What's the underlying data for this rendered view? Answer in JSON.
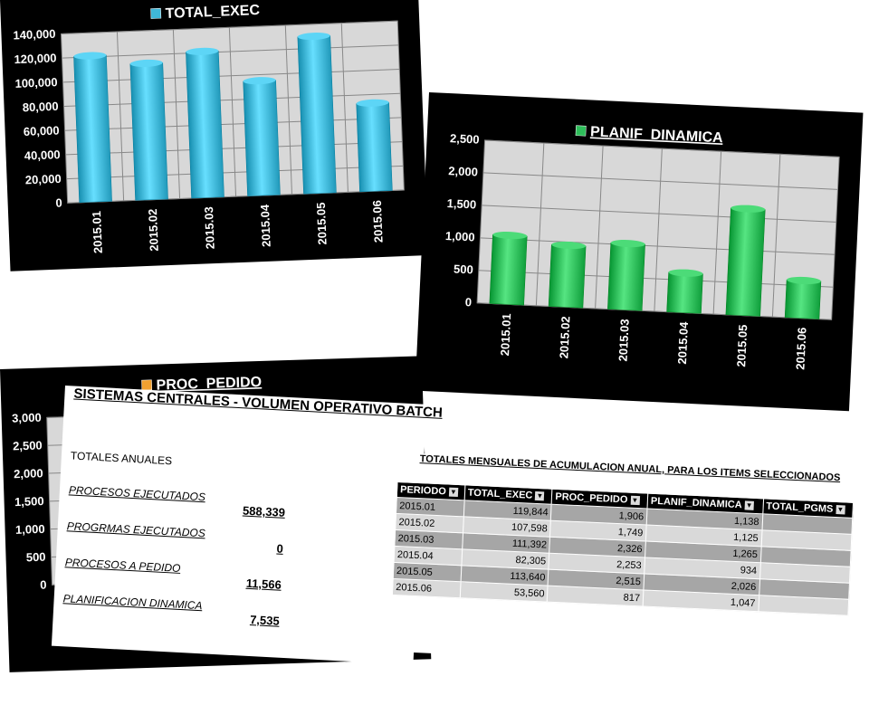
{
  "chart_data": [
    {
      "id": "total_exec",
      "type": "bar",
      "title": "TOTAL_EXEC",
      "categories": [
        "2015.01",
        "2015.02",
        "2015.03",
        "2015.04",
        "2015.05",
        "2015.06"
      ],
      "values": [
        121000,
        113000,
        121000,
        95000,
        130000,
        73000
      ],
      "ylim": [
        0,
        140000
      ],
      "yticks": [
        "0",
        "20,000",
        "40,000",
        "60,000",
        "80,000",
        "100,000",
        "120,000",
        "140,000"
      ],
      "color": "#3fb7d8",
      "grid": true
    },
    {
      "id": "planif_dinamica",
      "type": "bar",
      "title": "PLANIF_DINAMICA",
      "categories": [
        "2015.01",
        "2015.02",
        "2015.03",
        "2015.04",
        "2015.05",
        "2015.06"
      ],
      "values": [
        1060,
        950,
        1020,
        610,
        1640,
        580
      ],
      "ylim": [
        0,
        2500
      ],
      "yticks": [
        "0",
        "500",
        "1,000",
        "1,500",
        "2,000",
        "2,500"
      ],
      "color": "#2ebd5a",
      "grid": true
    },
    {
      "id": "proc_pedido",
      "type": "bar",
      "title": "PROC_PEDIDO",
      "ylim": [
        0,
        3000
      ],
      "yticks": [
        "0",
        "500",
        "1,000",
        "1,500",
        "2,000",
        "2,500",
        "3,000"
      ],
      "color": "#f0a030",
      "grid": true
    }
  ],
  "sheet": {
    "title": "SISTEMAS CENTRALES - VOLUMEN OPERATIVO BATCH",
    "totals_header": "TOTALES ANUALES",
    "totals": [
      {
        "label": "PROCESOS EJECUTADOS",
        "value": "588,339"
      },
      {
        "label": "PROGRMAS EJECUTADOS",
        "value": "0"
      },
      {
        "label": "PROCESOS A PEDIDO",
        "value": "11,566"
      },
      {
        "label": "PLANIFICACION DINAMICA",
        "value": "7,535"
      }
    ]
  },
  "monthly": {
    "title": "TOTALES MENSUALES DE ACUMULACION ANUAL, PARA LOS ITEMS SELECCIONADOS",
    "headers": [
      "PERIODO",
      "TOTAL_EXEC",
      "PROC_PEDIDO",
      "PLANIF_DINAMICA",
      "TOTAL_PGMS"
    ],
    "rows": [
      [
        "2015.01",
        "119,844",
        "1,906",
        "1,138",
        ""
      ],
      [
        "2015.02",
        "107,598",
        "1,749",
        "1,125",
        ""
      ],
      [
        "2015.03",
        "111,392",
        "2,326",
        "1,265",
        ""
      ],
      [
        "2015.04",
        "82,305",
        "2,253",
        "934",
        ""
      ],
      [
        "2015.05",
        "113,640",
        "2,515",
        "2,026",
        ""
      ],
      [
        "2015.06",
        "53,560",
        "817",
        "1,047",
        ""
      ]
    ]
  }
}
